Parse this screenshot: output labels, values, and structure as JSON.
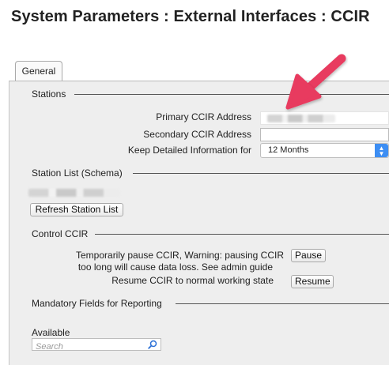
{
  "page": {
    "title": "System Parameters : External Interfaces : CCIR"
  },
  "tabs": [
    {
      "label": "General",
      "active": true
    }
  ],
  "stations": {
    "heading": "Stations",
    "primary_label": "Primary CCIR Address",
    "primary_value_redacted": true,
    "secondary_label": "Secondary CCIR Address",
    "secondary_value": "",
    "keep_label": "Keep Detailed Information for",
    "keep_value": "12 Months"
  },
  "station_list": {
    "heading": "Station List (Schema)",
    "value_redacted": true,
    "refresh_label": "Refresh Station List"
  },
  "control": {
    "heading": "Control CCIR",
    "pause_text_line1": "Temporarily pause CCIR, Warning: pausing CCIR",
    "pause_text_line2": "too long will cause data loss. See admin guide",
    "pause_label": "Pause",
    "resume_text": "Resume CCIR to normal working state",
    "resume_label": "Resume"
  },
  "mandatory": {
    "heading": "Mandatory Fields for Reporting",
    "available_label": "Available",
    "search_placeholder": "Search"
  },
  "icons": {
    "stepper": "chevron-updown-icon",
    "search": "magnifier-icon",
    "annotation": "pointer-arrow-icon"
  },
  "colors": {
    "accent": "#3d8ef3",
    "arrow": "#e83a5f",
    "panel": "#eeeeee"
  }
}
